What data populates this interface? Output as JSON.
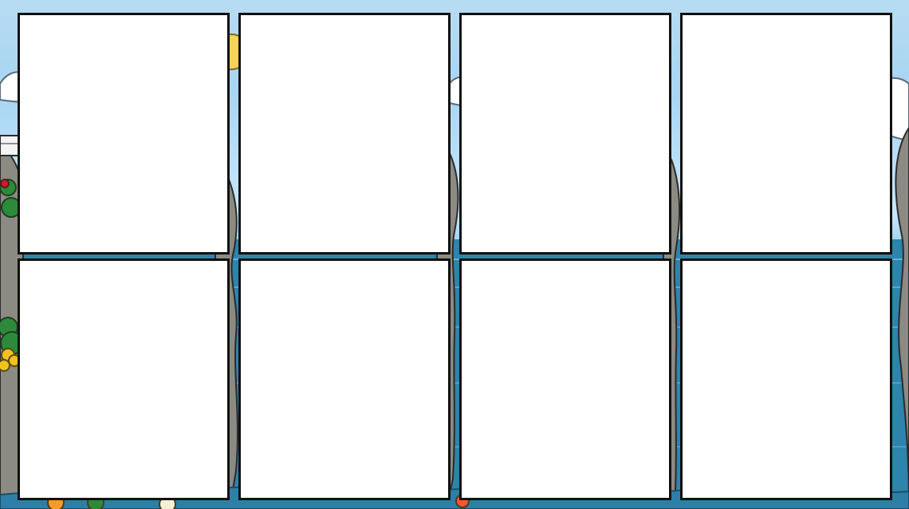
{
  "scene": {
    "sky_color": "#a7d5f3",
    "sea_color": "#2d7fa8",
    "rock_color": "#8b8b83",
    "foliage_color": "#2d8a3a"
  },
  "panels": [
    {
      "id": "panel-1"
    },
    {
      "id": "panel-2"
    },
    {
      "id": "panel-3"
    },
    {
      "id": "panel-4"
    },
    {
      "id": "panel-5"
    },
    {
      "id": "panel-6"
    },
    {
      "id": "panel-7"
    },
    {
      "id": "panel-8"
    }
  ]
}
